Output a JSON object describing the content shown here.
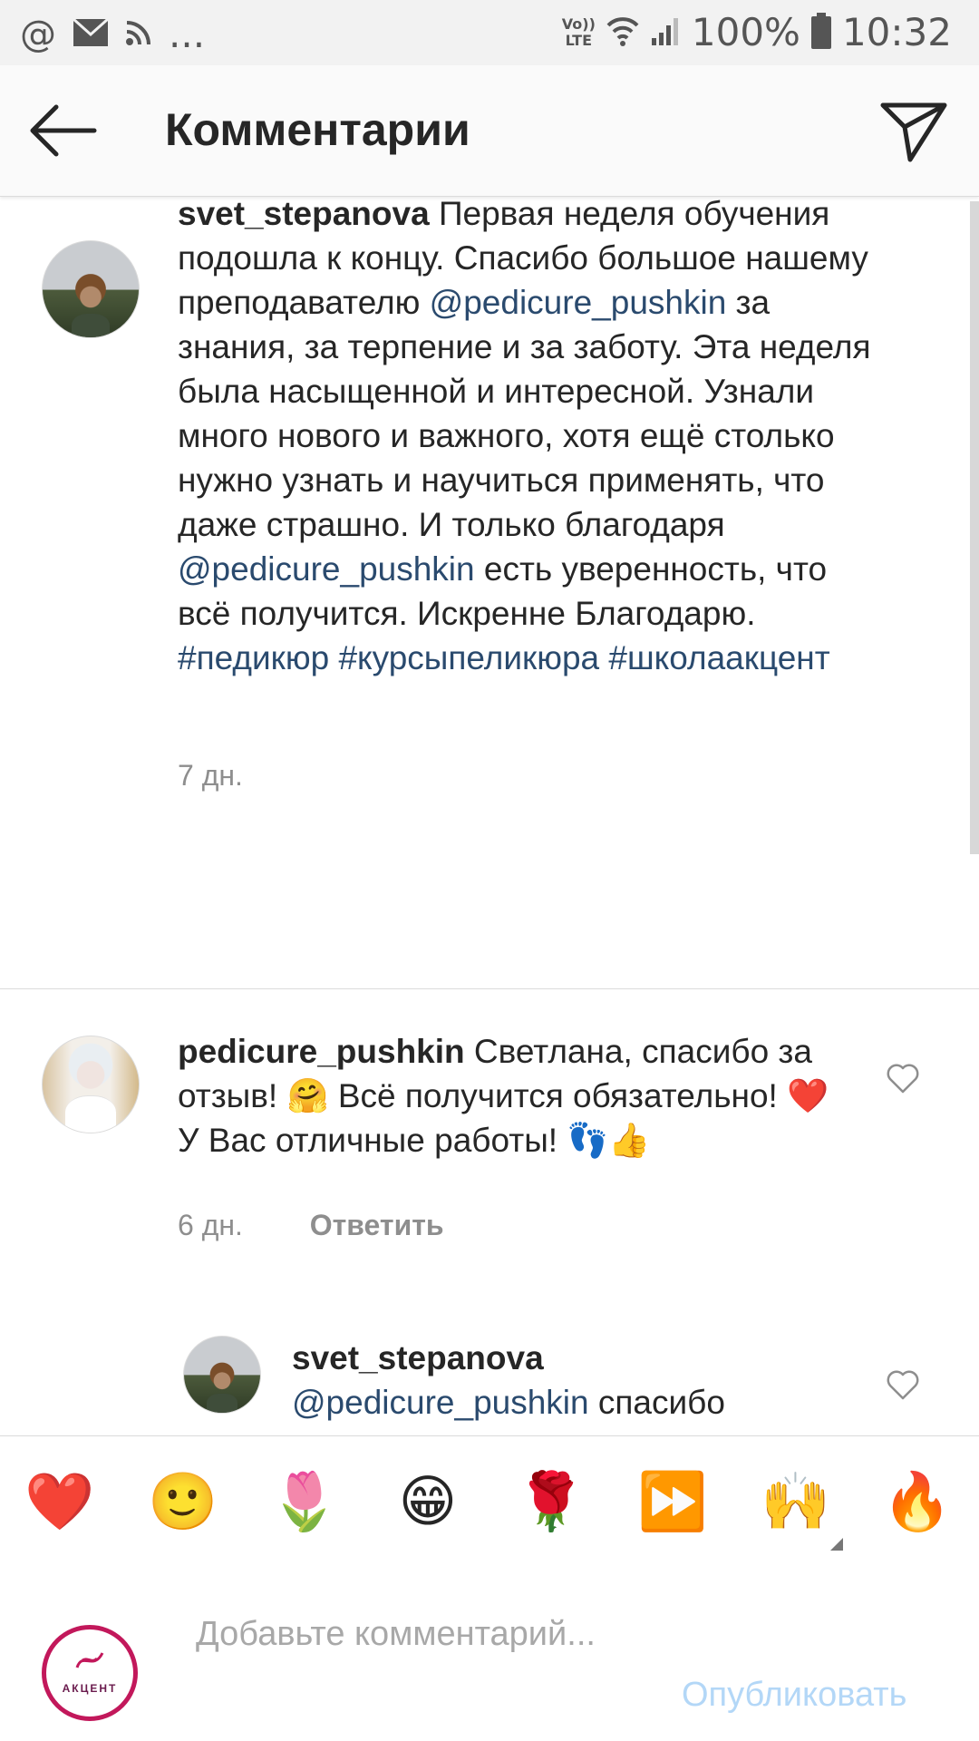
{
  "status_bar": {
    "left_icons": [
      "at-icon",
      "mail-icon",
      "rss-icon"
    ],
    "more": "...",
    "volte_top": "Vo))",
    "volte_bottom": "LTE",
    "battery": "100%",
    "time": "10:32"
  },
  "header": {
    "title": "Комментарии"
  },
  "comments": [
    {
      "username": "svet_stepanova",
      "segments": {
        "t1": "Первая неделя обучения подошла к концу. Спасибо большое нашему преподавателю ",
        "m1": "@pedicure_pushkin",
        "t2": " за знания, за терпение и за заботу. Эта неделя была насыщенной и интересной. Узнали много нового и важного, хотя ещё столько нужно узнать и научиться применять, что даже страшно. И только благодаря ",
        "m2": "@pedicure_pushkin",
        "t3": " есть уверенность, что всё получится. Искренне Благодарю. ",
        "h1": "#педикюр",
        "h2": "#курсыпеликюра",
        "h3": "#школаакцент"
      },
      "time": "7 дн."
    },
    {
      "username": "pedicure_pushkin",
      "text": "Светлана, спасибо за отзыв! 🤗 Всё получится обязательно! ❤️У Вас отличные работы! 👣👍",
      "time": "6 дн.",
      "reply_label": "Ответить"
    },
    {
      "username": "svet_stepanova",
      "mention": "@pedicure_pushkin",
      "text": "спасибо"
    }
  ],
  "emoji_bar": [
    "❤️",
    "🙂",
    "🌷",
    "😁",
    "🌹",
    "⏩",
    "🙌",
    "🔥"
  ],
  "composer": {
    "avatar_text": "АКЦЕНТ",
    "placeholder": "Добавьте комментарий...",
    "publish_label": "Опубликовать"
  },
  "colors": {
    "link": "#2a4a6e",
    "muted": "#8e8e8e",
    "publish_disabled": "#b3d7f7",
    "divider": "#dbdbdb"
  }
}
